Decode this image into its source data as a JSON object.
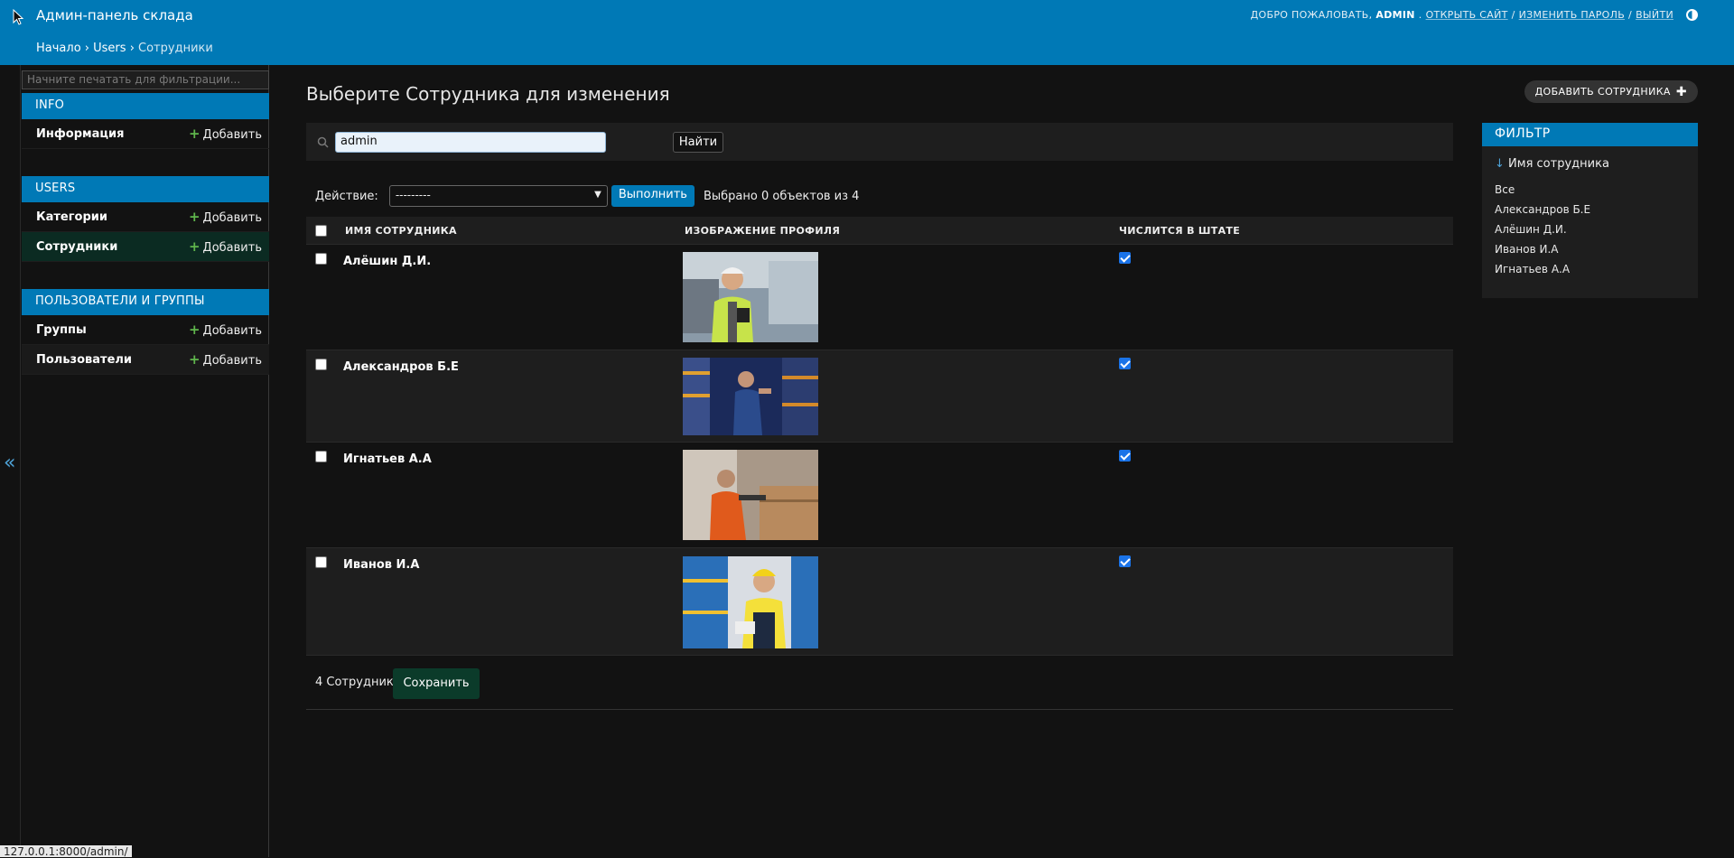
{
  "header": {
    "site_name": "Админ-панель склада",
    "welcome": "ДОБРО ПОЖАЛОВАТЬ,",
    "username": "ADMIN",
    "links": [
      "ОТКРЫТЬ САЙТ",
      "ИЗМЕНИТЬ ПАРОЛЬ",
      "ВЫЙТИ"
    ],
    "separator": "/",
    "breadcrumbs": [
      "Начало",
      "Users",
      "Сотрудники"
    ],
    "breadcrumb_sep": "›"
  },
  "sidebar": {
    "filter_placeholder": "Начните печатать для фильтрации...",
    "add_label": "Добавить",
    "modules": [
      {
        "caption": "INFO",
        "items": [
          "Информация"
        ]
      },
      {
        "caption": "USERS",
        "items": [
          "Категории",
          "Сотрудники"
        ]
      },
      {
        "caption": "ПОЛЬЗОВАТЕЛИ И ГРУППЫ",
        "items": [
          "Группы",
          "Пользователи"
        ]
      }
    ],
    "active_item": "Сотрудники",
    "collapse_icon": "«"
  },
  "main": {
    "title": "Выберите Сотрудника для изменения",
    "add_button": "ДОБАВИТЬ СОТРУДНИКА",
    "search": {
      "value": "admin",
      "button": "Найти"
    },
    "actions": {
      "label": "Действие:",
      "select_value": "---------",
      "run_button": "Выполнить",
      "selection_count": "Выбрано 0 объектов из 4"
    },
    "table": {
      "columns": [
        "ИМЯ СОТРУДНИКА",
        "ИЗОБРАЖЕНИЕ ПРОФИЛЯ",
        "ЧИСЛИТСЯ В ШТАТЕ"
      ],
      "rows": [
        {
          "name": "Алёшин Д.И.",
          "on_staff": true
        },
        {
          "name": "Александров Б.Е",
          "on_staff": true
        },
        {
          "name": "Игнатьев А.А",
          "on_staff": true
        },
        {
          "name": "Иванов И.А",
          "on_staff": true
        }
      ]
    },
    "footer": {
      "count": "4 Сотрудники",
      "save_button": "Сохранить"
    }
  },
  "filter": {
    "header": "ФИЛЬТР",
    "title": "Имя сотрудника",
    "arrow": "↓",
    "options": [
      "Все",
      "Александров Б.Е",
      "Алёшин Д.И.",
      "Иванов И.А",
      "Игнатьев А.А"
    ]
  },
  "status_bar": {
    "url": "127.0.0.1:8000/admin/"
  },
  "colors": {
    "accent": "#0079b6",
    "background": "#121212",
    "row_alt": "#1e1e1e",
    "save": "#0b3b2a"
  }
}
